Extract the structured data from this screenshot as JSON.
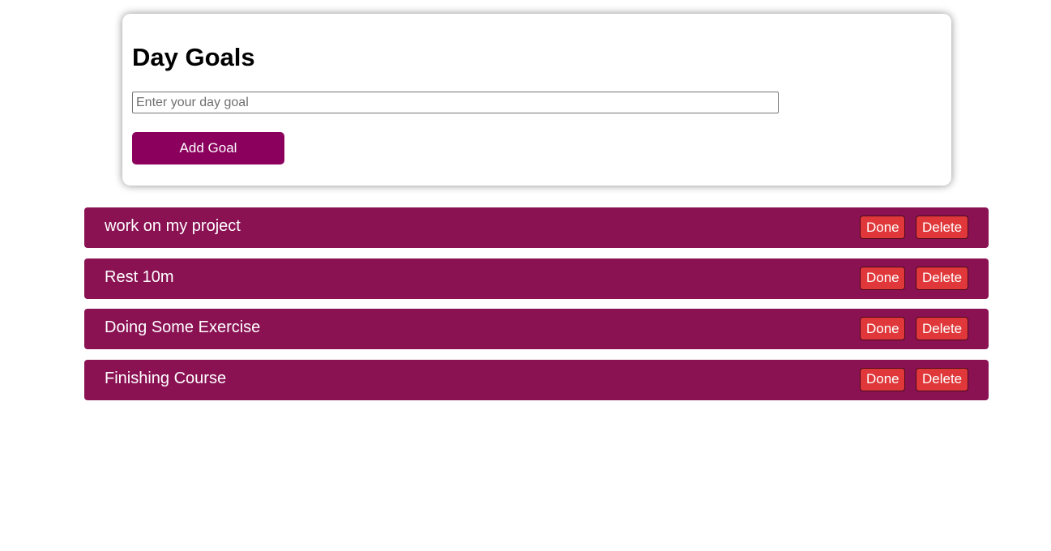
{
  "form": {
    "title": "Day Goals",
    "input_placeholder": "Enter your day goal",
    "input_value": "",
    "add_button_label": "Add Goal"
  },
  "goals": [
    {
      "text": "work on my project",
      "done_label": "Done",
      "delete_label": "Delete"
    },
    {
      "text": "Rest 10m",
      "done_label": "Done",
      "delete_label": "Delete"
    },
    {
      "text": "Doing Some Exercise",
      "done_label": "Done",
      "delete_label": "Delete"
    },
    {
      "text": "Finishing Course",
      "done_label": "Done",
      "delete_label": "Delete"
    }
  ],
  "colors": {
    "primary": "#8b005d",
    "goal_item_bg": "#8a1253",
    "action_button_bg": "#e0383a"
  }
}
